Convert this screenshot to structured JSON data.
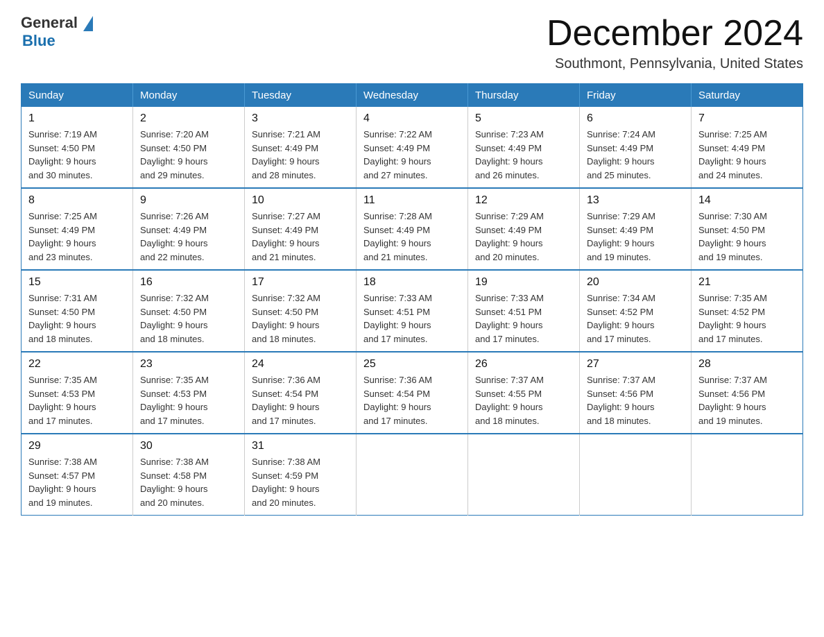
{
  "logo": {
    "general": "General",
    "blue": "Blue"
  },
  "title": "December 2024",
  "subtitle": "Southmont, Pennsylvania, United States",
  "weekdays": [
    "Sunday",
    "Monday",
    "Tuesday",
    "Wednesday",
    "Thursday",
    "Friday",
    "Saturday"
  ],
  "weeks": [
    [
      {
        "day": "1",
        "sunrise": "7:19 AM",
        "sunset": "4:50 PM",
        "daylight": "9 hours and 30 minutes."
      },
      {
        "day": "2",
        "sunrise": "7:20 AM",
        "sunset": "4:50 PM",
        "daylight": "9 hours and 29 minutes."
      },
      {
        "day": "3",
        "sunrise": "7:21 AM",
        "sunset": "4:49 PM",
        "daylight": "9 hours and 28 minutes."
      },
      {
        "day": "4",
        "sunrise": "7:22 AM",
        "sunset": "4:49 PM",
        "daylight": "9 hours and 27 minutes."
      },
      {
        "day": "5",
        "sunrise": "7:23 AM",
        "sunset": "4:49 PM",
        "daylight": "9 hours and 26 minutes."
      },
      {
        "day": "6",
        "sunrise": "7:24 AM",
        "sunset": "4:49 PM",
        "daylight": "9 hours and 25 minutes."
      },
      {
        "day": "7",
        "sunrise": "7:25 AM",
        "sunset": "4:49 PM",
        "daylight": "9 hours and 24 minutes."
      }
    ],
    [
      {
        "day": "8",
        "sunrise": "7:25 AM",
        "sunset": "4:49 PM",
        "daylight": "9 hours and 23 minutes."
      },
      {
        "day": "9",
        "sunrise": "7:26 AM",
        "sunset": "4:49 PM",
        "daylight": "9 hours and 22 minutes."
      },
      {
        "day": "10",
        "sunrise": "7:27 AM",
        "sunset": "4:49 PM",
        "daylight": "9 hours and 21 minutes."
      },
      {
        "day": "11",
        "sunrise": "7:28 AM",
        "sunset": "4:49 PM",
        "daylight": "9 hours and 21 minutes."
      },
      {
        "day": "12",
        "sunrise": "7:29 AM",
        "sunset": "4:49 PM",
        "daylight": "9 hours and 20 minutes."
      },
      {
        "day": "13",
        "sunrise": "7:29 AM",
        "sunset": "4:49 PM",
        "daylight": "9 hours and 19 minutes."
      },
      {
        "day": "14",
        "sunrise": "7:30 AM",
        "sunset": "4:50 PM",
        "daylight": "9 hours and 19 minutes."
      }
    ],
    [
      {
        "day": "15",
        "sunrise": "7:31 AM",
        "sunset": "4:50 PM",
        "daylight": "9 hours and 18 minutes."
      },
      {
        "day": "16",
        "sunrise": "7:32 AM",
        "sunset": "4:50 PM",
        "daylight": "9 hours and 18 minutes."
      },
      {
        "day": "17",
        "sunrise": "7:32 AM",
        "sunset": "4:50 PM",
        "daylight": "9 hours and 18 minutes."
      },
      {
        "day": "18",
        "sunrise": "7:33 AM",
        "sunset": "4:51 PM",
        "daylight": "9 hours and 17 minutes."
      },
      {
        "day": "19",
        "sunrise": "7:33 AM",
        "sunset": "4:51 PM",
        "daylight": "9 hours and 17 minutes."
      },
      {
        "day": "20",
        "sunrise": "7:34 AM",
        "sunset": "4:52 PM",
        "daylight": "9 hours and 17 minutes."
      },
      {
        "day": "21",
        "sunrise": "7:35 AM",
        "sunset": "4:52 PM",
        "daylight": "9 hours and 17 minutes."
      }
    ],
    [
      {
        "day": "22",
        "sunrise": "7:35 AM",
        "sunset": "4:53 PM",
        "daylight": "9 hours and 17 minutes."
      },
      {
        "day": "23",
        "sunrise": "7:35 AM",
        "sunset": "4:53 PM",
        "daylight": "9 hours and 17 minutes."
      },
      {
        "day": "24",
        "sunrise": "7:36 AM",
        "sunset": "4:54 PM",
        "daylight": "9 hours and 17 minutes."
      },
      {
        "day": "25",
        "sunrise": "7:36 AM",
        "sunset": "4:54 PM",
        "daylight": "9 hours and 17 minutes."
      },
      {
        "day": "26",
        "sunrise": "7:37 AM",
        "sunset": "4:55 PM",
        "daylight": "9 hours and 18 minutes."
      },
      {
        "day": "27",
        "sunrise": "7:37 AM",
        "sunset": "4:56 PM",
        "daylight": "9 hours and 18 minutes."
      },
      {
        "day": "28",
        "sunrise": "7:37 AM",
        "sunset": "4:56 PM",
        "daylight": "9 hours and 19 minutes."
      }
    ],
    [
      {
        "day": "29",
        "sunrise": "7:38 AM",
        "sunset": "4:57 PM",
        "daylight": "9 hours and 19 minutes."
      },
      {
        "day": "30",
        "sunrise": "7:38 AM",
        "sunset": "4:58 PM",
        "daylight": "9 hours and 20 minutes."
      },
      {
        "day": "31",
        "sunrise": "7:38 AM",
        "sunset": "4:59 PM",
        "daylight": "9 hours and 20 minutes."
      },
      null,
      null,
      null,
      null
    ]
  ],
  "labels": {
    "sunrise": "Sunrise:",
    "sunset": "Sunset:",
    "daylight": "Daylight:"
  }
}
